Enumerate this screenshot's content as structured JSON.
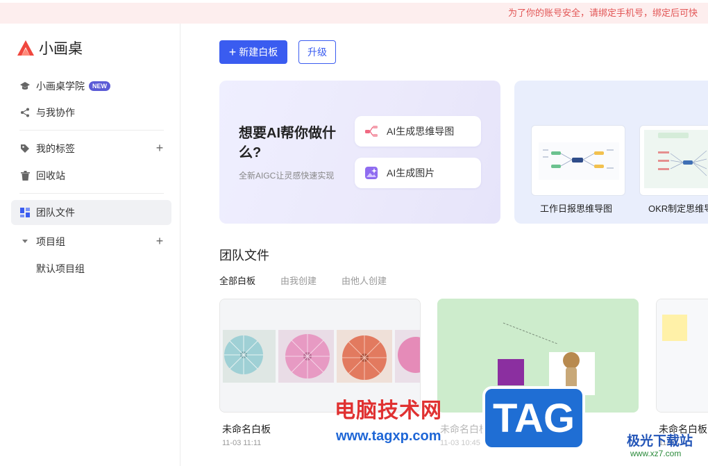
{
  "notice": {
    "text": "为了你的账号安全，请绑定手机号，绑定后可快"
  },
  "app": {
    "name": "小画桌"
  },
  "sidebar": {
    "items": [
      {
        "label": "小画桌学院",
        "badge": "NEW"
      },
      {
        "label": "与我协作"
      },
      {
        "label": "我的标签"
      },
      {
        "label": "回收站"
      },
      {
        "label": "团队文件"
      },
      {
        "label": "项目组"
      },
      {
        "label": "默认项目组"
      }
    ]
  },
  "toolbar": {
    "new_label": "新建白板",
    "upgrade_label": "升级"
  },
  "ai_card": {
    "title": "想要AI帮你做什么?",
    "subtitle": "全新AIGC让灵感快速实现",
    "mindmap_label": "AI生成思维导图",
    "image_label": "AI生成图片"
  },
  "templates": [
    {
      "label": "工作日报思维导图"
    },
    {
      "label": "OKR制定思维导"
    }
  ],
  "section": {
    "title": "团队文件",
    "tabs": [
      "全部白板",
      "由我创建",
      "由他人创建"
    ]
  },
  "files": [
    {
      "name": "未命名白板",
      "date": "11-03 11:11"
    },
    {
      "name": "未命名白板",
      "date": "11-03 10:45"
    },
    {
      "name": "未命名白板",
      "date": "11-03"
    }
  ],
  "watermark": {
    "cn": "电脑技术网",
    "url": "www.tagxp.com",
    "tag": "TAG",
    "brand": "极光下载站",
    "brand_url": "www.xz7.com"
  },
  "colors": {
    "accent": "#3a5cf0",
    "notice": "#e25555",
    "badge": "#5b5bd6"
  }
}
